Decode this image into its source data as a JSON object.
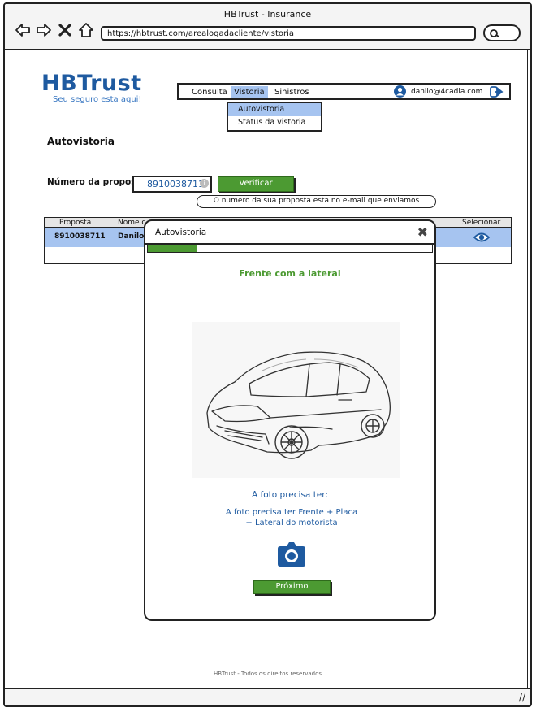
{
  "window": {
    "title": "HBTrust - Insurance"
  },
  "browser": {
    "url": "https://hbtrust.com/arealogadacliente/vistoria"
  },
  "logo": {
    "name": "HBTrust",
    "tagline": "Seu seguro esta aqui!"
  },
  "menu": {
    "items": [
      {
        "label": "Consulta"
      },
      {
        "label": "Vistoria"
      },
      {
        "label": "Sinistros"
      }
    ],
    "user_email": "danilo@4cadia.com"
  },
  "dropdown": {
    "items": [
      {
        "label": "Autovistoria"
      },
      {
        "label": "Status da vistoria"
      }
    ]
  },
  "page": {
    "heading": "Autovistoria"
  },
  "proposal": {
    "label": "Número da proposta",
    "value": "8910038711",
    "info_icon": "i",
    "verify_label": "Verificar",
    "tooltip": "O numero da sua proposta esta no e-mail que enviamos"
  },
  "table": {
    "headers": [
      "Proposta",
      "Nome c",
      "Selecionar"
    ],
    "row": {
      "proposta": "8910038711",
      "nome": "Danilo"
    }
  },
  "modal": {
    "title": "Autovistoria",
    "close_icon": "✖",
    "progress": 0.17,
    "step_title": "Frente com a lateral",
    "req_title": "A foto precisa ter:",
    "req_text_line1": "A foto precisa ter Frente + Placa",
    "req_text_line2": "+ Lateral do motorista",
    "next_label": "Próximo"
  },
  "footer": {
    "text": "HBTrust - Todos os direitos reservados"
  },
  "colors": {
    "brand": "#1e5aa0",
    "accent_green": "#4c9a32",
    "highlight": "#a6c4f0"
  }
}
